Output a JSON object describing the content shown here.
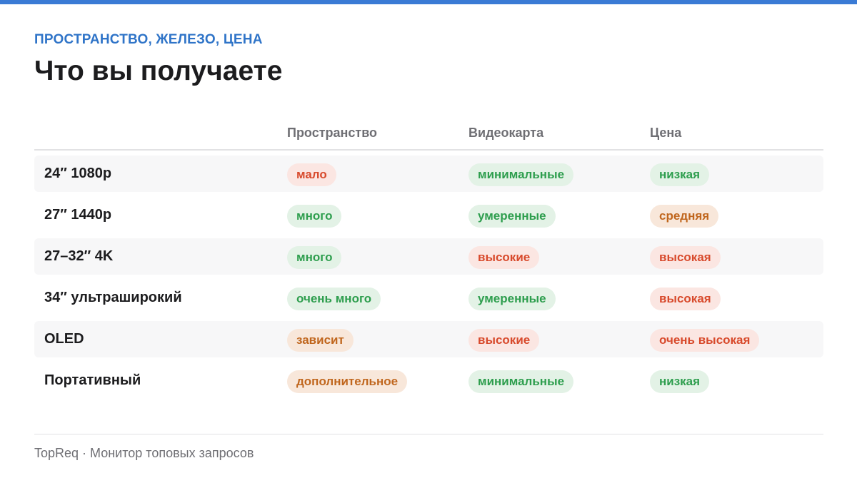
{
  "colors": {
    "accent": "#3a7bd5",
    "eyebrow": "#2f74c8",
    "good": "#2e9e4e",
    "bad": "#d84a2c",
    "mid": "#c0661d"
  },
  "header": {
    "eyebrow": "ПРОСТРАНСТВО, ЖЕЛЕЗО, ЦЕНА",
    "title": "Что вы получаете"
  },
  "table": {
    "columns": [
      "Пространство",
      "Видеокарта",
      "Цена"
    ],
    "rows": [
      {
        "label": "24″ 1080p",
        "cells": [
          {
            "text": "мало",
            "tone": "bad"
          },
          {
            "text": "минимальные",
            "tone": "good"
          },
          {
            "text": "низкая",
            "tone": "good"
          }
        ]
      },
      {
        "label": "27″ 1440p",
        "cells": [
          {
            "text": "много",
            "tone": "good"
          },
          {
            "text": "умеренные",
            "tone": "good"
          },
          {
            "text": "средняя",
            "tone": "mid"
          }
        ]
      },
      {
        "label": "27–32″ 4K",
        "cells": [
          {
            "text": "много",
            "tone": "good"
          },
          {
            "text": "высокие",
            "tone": "bad"
          },
          {
            "text": "высокая",
            "tone": "bad"
          }
        ]
      },
      {
        "label": "34″ ультраширокий",
        "cells": [
          {
            "text": "очень много",
            "tone": "good"
          },
          {
            "text": "умеренные",
            "tone": "good"
          },
          {
            "text": "высокая",
            "tone": "bad"
          }
        ]
      },
      {
        "label": "OLED",
        "cells": [
          {
            "text": "зависит",
            "tone": "mid"
          },
          {
            "text": "высокие",
            "tone": "bad"
          },
          {
            "text": "очень высокая",
            "tone": "bad"
          }
        ]
      },
      {
        "label": "Портативный",
        "cells": [
          {
            "text": "дополнительное",
            "tone": "mid"
          },
          {
            "text": "минимальные",
            "tone": "good"
          },
          {
            "text": "низкая",
            "tone": "good"
          }
        ]
      }
    ]
  },
  "footer": {
    "text": "TopReq · Монитор топовых запросов"
  }
}
